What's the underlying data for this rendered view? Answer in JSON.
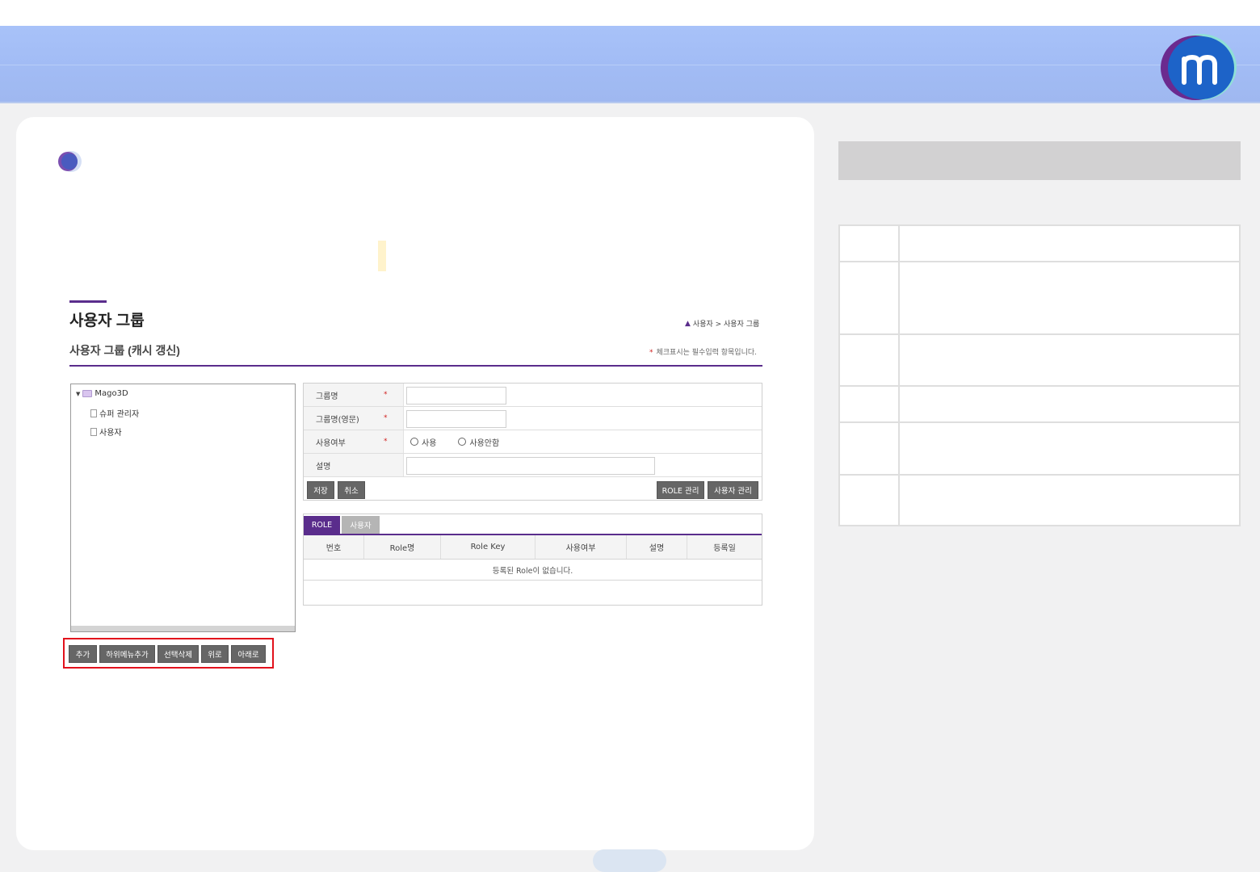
{
  "header": {
    "logo_icon": "mago3d-logo"
  },
  "page": {
    "title": "사용자 그룹",
    "subtitle": "사용자 그룹 (캐시 갱신)",
    "breadcrumb": "사용자 > 사용자 그룹",
    "required_star": "*",
    "required_note": "체크표시는 필수입력 항목입니다."
  },
  "tree": {
    "root": "Mago3D",
    "children": [
      "슈퍼 관리자",
      "사용자"
    ]
  },
  "tree_buttons": {
    "add": "추가",
    "add_sub": "하위메뉴추가",
    "delete_selected": "선택삭제",
    "up": "위로",
    "down": "아래로"
  },
  "form": {
    "group_name_label": "그룹명",
    "group_name_en_label": "그룹명(영문)",
    "use_label": "사용여부",
    "desc_label": "설명",
    "req_mark": "*",
    "use_option": "사용",
    "unuse_option": "사용안함",
    "group_name_value": "",
    "group_name_en_value": "",
    "desc_value": ""
  },
  "form_buttons": {
    "save": "저장",
    "cancel": "취소",
    "role_manage": "ROLE 관리",
    "user_manage": "사용자 관리"
  },
  "tabs": {
    "role": "ROLE",
    "user": "사용자",
    "columns": [
      "번호",
      "Role명",
      "Role Key",
      "사용여부",
      "설명",
      "등록일"
    ],
    "empty_message": "등록된 Role이 없습니다."
  },
  "colors": {
    "accent": "#5a2d8c",
    "banner": "#a4bef6",
    "button": "#666666",
    "highlight_border": "#e2111c"
  }
}
